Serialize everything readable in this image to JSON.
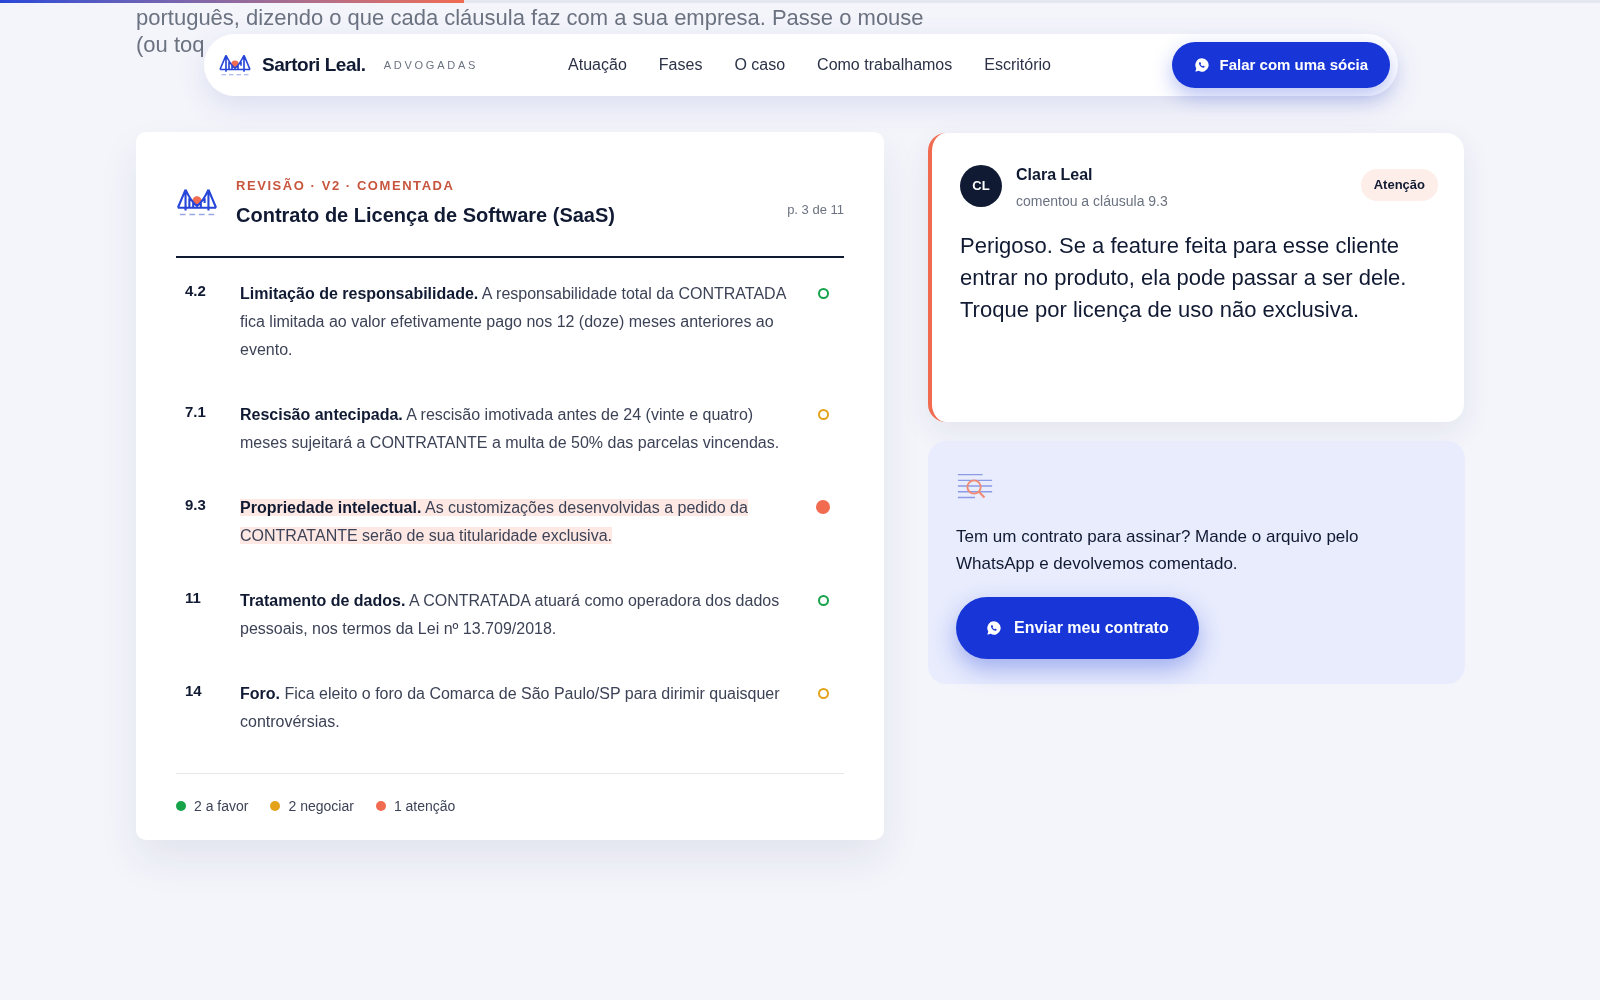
{
  "reading_progress": {
    "level": 0.29
  },
  "lead_text": [
    "português, dizendo o que cada cláusula faz com a sua empresa. Passe o mouse",
    "(ou toq"
  ],
  "nav": {
    "brand": "Sartori Leal.",
    "tagline": "ADVOGADAS",
    "links": [
      "Atuação",
      "Fases",
      "O caso",
      "Como trabalhamos",
      "Escritório"
    ],
    "cta": "Falar com uma sócia"
  },
  "document": {
    "eyebrow": "REVISÃO · V2 · COMENTADA",
    "title": "Contrato de Licença de Software (SaaS)",
    "page": "p. 3 de 11",
    "clauses": [
      {
        "number": "4.2",
        "text": "**Limitação de responsabilidade.** A responsabilidade total da CONTRATADA fica limitada ao valor efetivamente pago nos 12 (doze) meses anteriores ao evento.",
        "color": "#16a34a",
        "selected": false
      },
      {
        "number": "7.1",
        "text": "**Rescisão antecipada.** A rescisão imotivada antes de 24 (vinte e quatro) meses sujeitará a CONTRATANTE a multa de 50% das parcelas vincendas.",
        "color": "#e3a21a",
        "selected": false
      },
      {
        "number": "9.3",
        "text": "**Propriedade intelectual.** As customizações desenvolvidas a pedido da CONTRATANTE serão de sua titularidade exclusiva.",
        "color": "#f06b4f",
        "selected": true
      },
      {
        "number": "11",
        "text": "**Tratamento de dados.** A CONTRATADA atuará como operadora dos dados pessoais, nos termos da Lei nº 13.709/2018.",
        "color": "#16a34a",
        "selected": false
      },
      {
        "number": "14",
        "text": "**Foro.** Fica eleito o foro da Comarca de São Paulo/SP para dirimir quaisquer controvérsias.",
        "color": "#e3a21a",
        "selected": false
      }
    ],
    "legend": [
      {
        "label": "2 a favor",
        "color": "#16a34a"
      },
      {
        "label": "2 negociar",
        "color": "#e3a21a"
      },
      {
        "label": "1 atenção",
        "color": "#f06b4f"
      }
    ]
  },
  "comment": {
    "initials": "CL",
    "author": "Clara Leal",
    "meta": "comentou a cláusula 9.3",
    "badge": "Atenção",
    "body": "Perigoso. Se a feature feita para esse cliente entrar no produto, ela pode passar a ser dele. Troque por licença de uso não exclusiva."
  },
  "cta_card": {
    "text": "Tem um contrato para assinar? Mande o arquivo pelo WhatsApp e devolvemos comentado.",
    "button": "Enviar meu contrato"
  }
}
